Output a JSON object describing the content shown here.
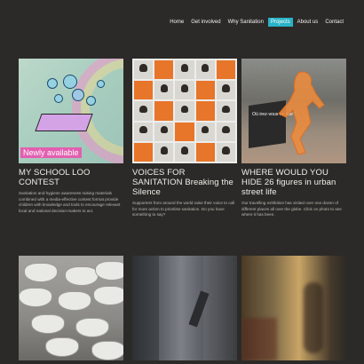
{
  "nav": {
    "items": [
      "Home",
      "Get involved",
      "Why Sanitation",
      "Projects",
      "About us",
      "Contact"
    ],
    "active_index": 3
  },
  "cards": [
    {
      "badge": "Newly available",
      "title": "MY SCHOOL LOO CONTEST",
      "description": "Sanitation and hygiene awareness raising materials combined with a media-effective contest format provide children with knowledge and tools to encourage relevant local and national decision-makers to act."
    },
    {
      "title": "VOICES FOR SANITATION Breaking the Silence",
      "description": "Supporters from around the world raise their voice to call for more action to prioritise sanitation. Do you have something to say?"
    },
    {
      "sign_text": "Où irez-vous ce soir?",
      "title": "WHERE WOULD YOU HIDE 26 figures in urban street life",
      "description": "Our travelling exhibition has visited over one dozen of different places all over the globe. Click on photo to see where it has been."
    }
  ],
  "colors": {
    "background": "#2b2a28",
    "accent": "#2ab3c7",
    "badge": "#e25fb0"
  }
}
